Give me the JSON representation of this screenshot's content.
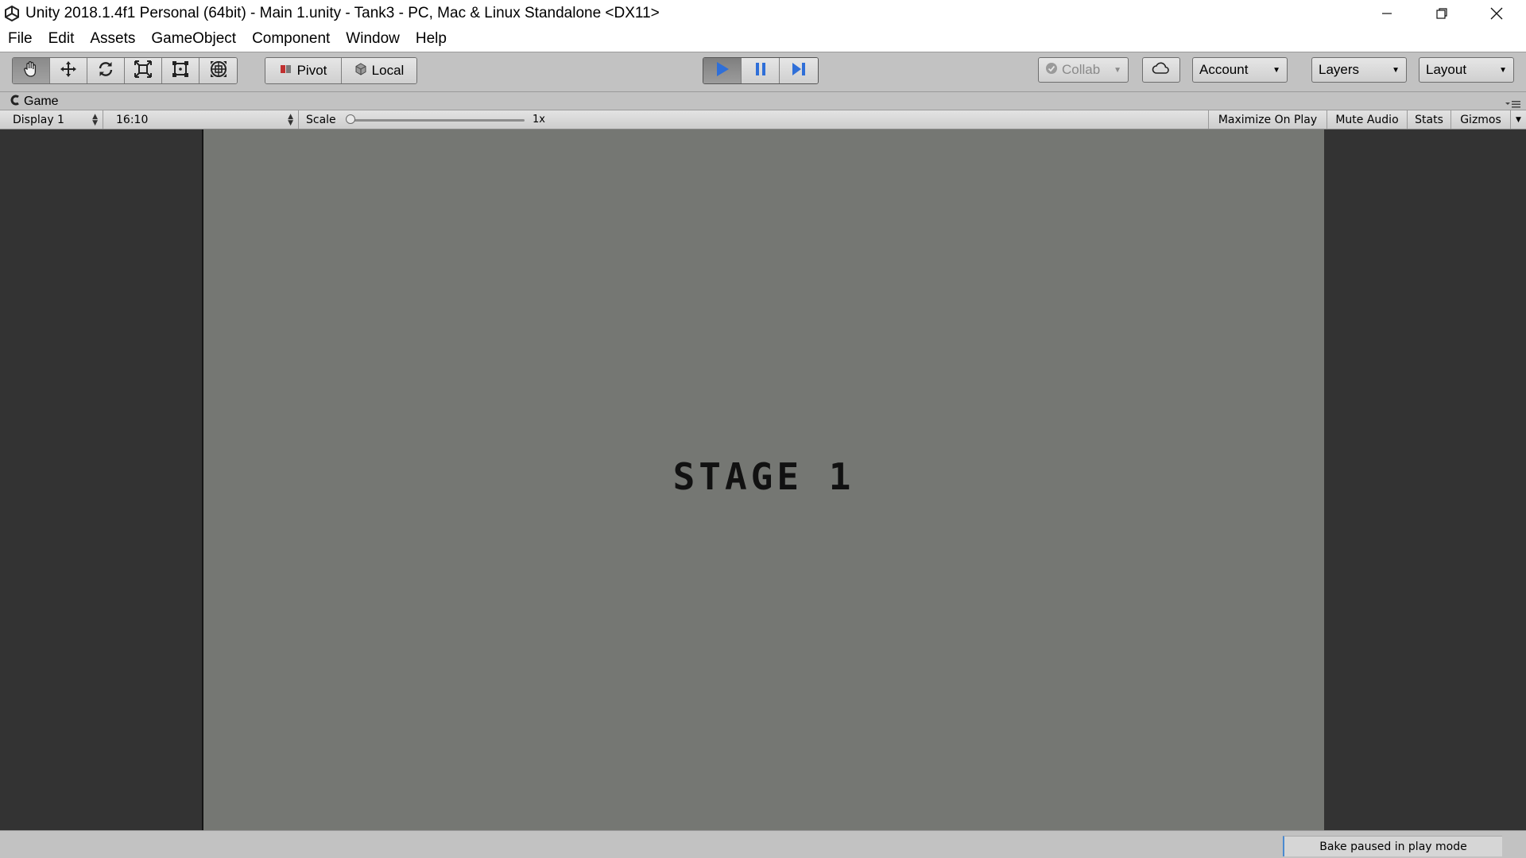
{
  "window": {
    "title": "Unity 2018.1.4f1 Personal (64bit) - Main 1.unity - Tank3 - PC, Mac & Linux Standalone <DX11>",
    "logo_icon": "unity-logo-icon",
    "controls": [
      "minimize-icon",
      "restore-icon",
      "close-icon"
    ]
  },
  "menu": {
    "items": [
      {
        "label": "File"
      },
      {
        "label": "Edit"
      },
      {
        "label": "Assets"
      },
      {
        "label": "GameObject"
      },
      {
        "label": "Component"
      },
      {
        "label": "Window"
      },
      {
        "label": "Help"
      }
    ]
  },
  "toolbar": {
    "transform_tools": [
      "hand-icon",
      "move-icon",
      "rotate-icon",
      "scale-icon",
      "rect-icon",
      "transform-icon"
    ],
    "active_tool": "hand-icon",
    "pivot_label": "Pivot",
    "local_label": "Local",
    "play_state": "playing",
    "collab_label": "Collab",
    "account_label": "Account",
    "layers_label": "Layers",
    "layout_label": "Layout",
    "accent_color": "#2f6fd8"
  },
  "game_panel": {
    "tab_label": "Game",
    "display_label": "Display 1",
    "aspect_label": "16:10",
    "scale_label": "Scale",
    "scale_value": "1x",
    "scale_level": 0,
    "maximize_label": "Maximize On Play",
    "mute_label": "Mute Audio",
    "stats_label": "Stats",
    "gizmos_label": "Gizmos"
  },
  "game_view": {
    "stage_text": "STAGE 1",
    "background_color": "#757773"
  },
  "status": {
    "message": "Bake paused in play mode"
  }
}
